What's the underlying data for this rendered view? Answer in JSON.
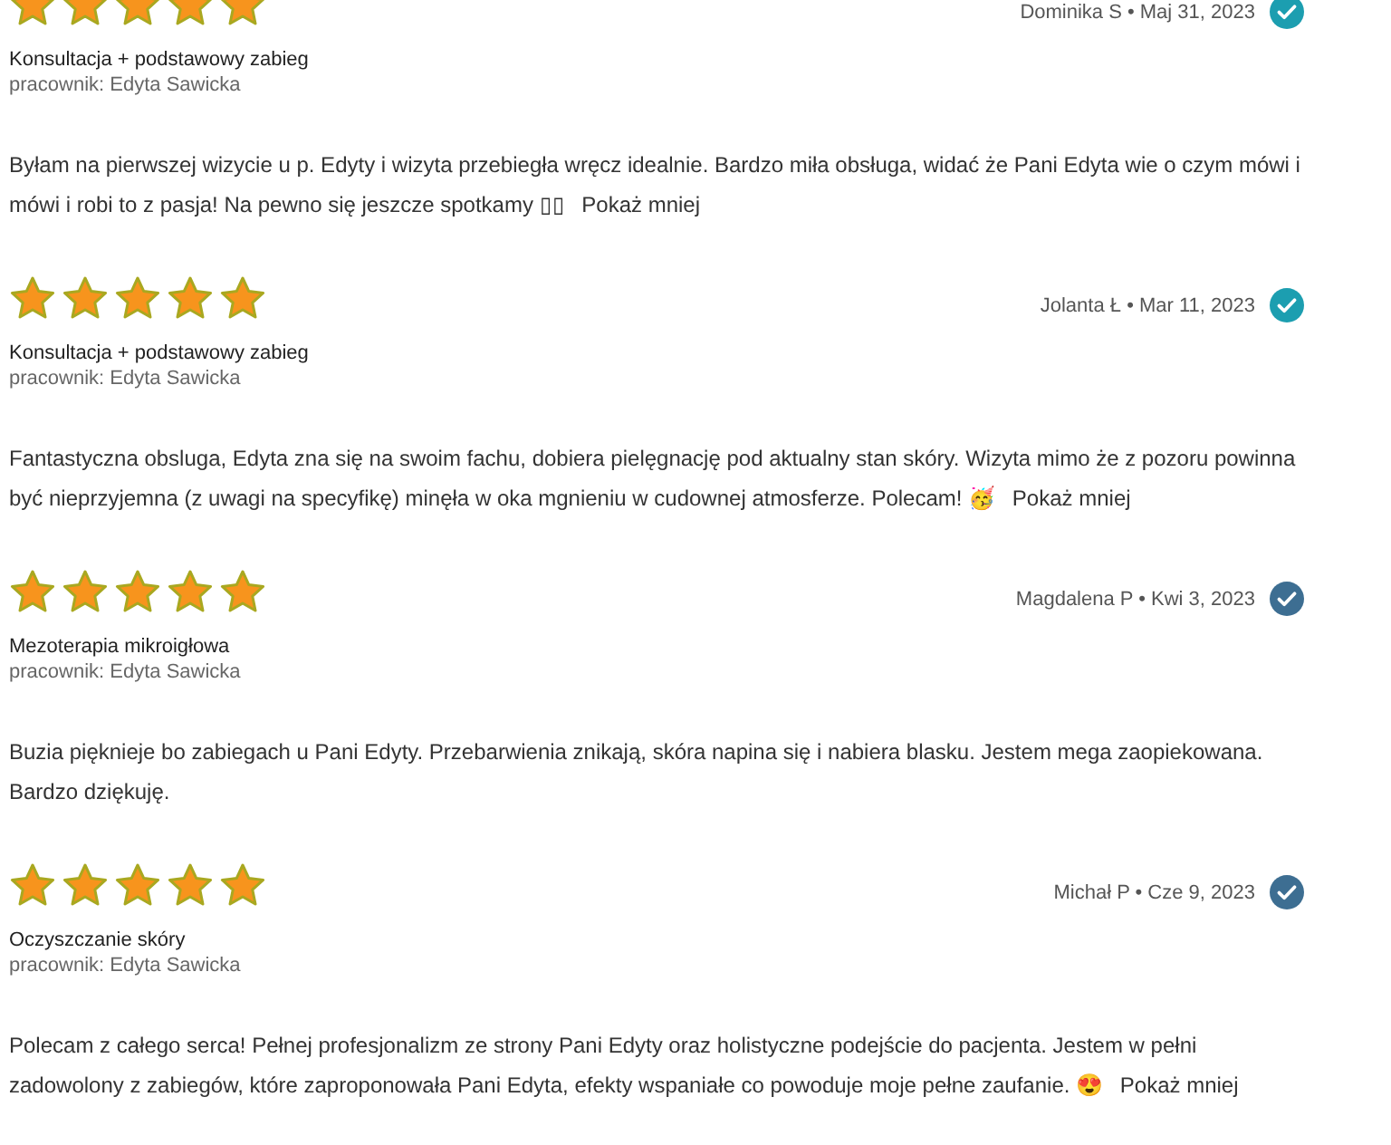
{
  "reviews": [
    {
      "stars": 5,
      "byline": "Dominika S • Maj 31, 2023",
      "verified": true,
      "service": "Konsultacja + podstawowy zabieg",
      "worker": "pracownik: Edyta Sawicka",
      "text": "Byłam na pierwszej wizycie u p. Edyty i wizyta przebiegła wręcz idealnie. Bardzo miła obsługa, widać że Pani Edyta wie o czym mówi i mówi i robi to z pasja! Na pewno się jeszcze spotkamy ▯▯",
      "toggle": "Pokaż mniej"
    },
    {
      "stars": 5,
      "byline": "Jolanta Ł • Mar 11, 2023",
      "verified": true,
      "service": "Konsultacja + podstawowy zabieg",
      "worker": "pracownik: Edyta Sawicka",
      "text": "Fantastyczna obsluga, Edyta zna się na swoim fachu, dobiera pielęgnację pod aktualny stan skóry. Wizyta mimo że z pozoru powinna być nieprzyjemna (z uwagi na specyfikę) minęła w oka mgnieniu w cudownej atmosferze. Polecam! 🥳",
      "toggle": "Pokaż mniej"
    },
    {
      "stars": 5,
      "byline": "Magdalena P • Kwi 3, 2023",
      "verified": true,
      "service": "Mezoterapia mikroigłowa",
      "worker": "pracownik: Edyta Sawicka",
      "text": "Buzia pięknieje bo zabiegach u Pani Edyty. Przebarwienia znikają, skóra napina się i nabiera blasku. Jestem mega zaopiekowana. Bardzo dziękuję."
    },
    {
      "stars": 5,
      "byline": "Michał P • Cze 9, 2023",
      "verified": true,
      "service": "Oczyszczanie skóry",
      "worker": "pracownik: Edyta Sawicka",
      "text": "Polecam z całego serca! Pełnej profesjonalizm ze strony Pani Edyty oraz holistyczne podejście do pacjenta. Jestem w pełni zadowolony z zabiegów, które zaproponowała Pani Edyta, efekty wspaniałe co powoduje moje pełne zaufanie. 😍",
      "toggle": "Pokaż mniej"
    }
  ]
}
